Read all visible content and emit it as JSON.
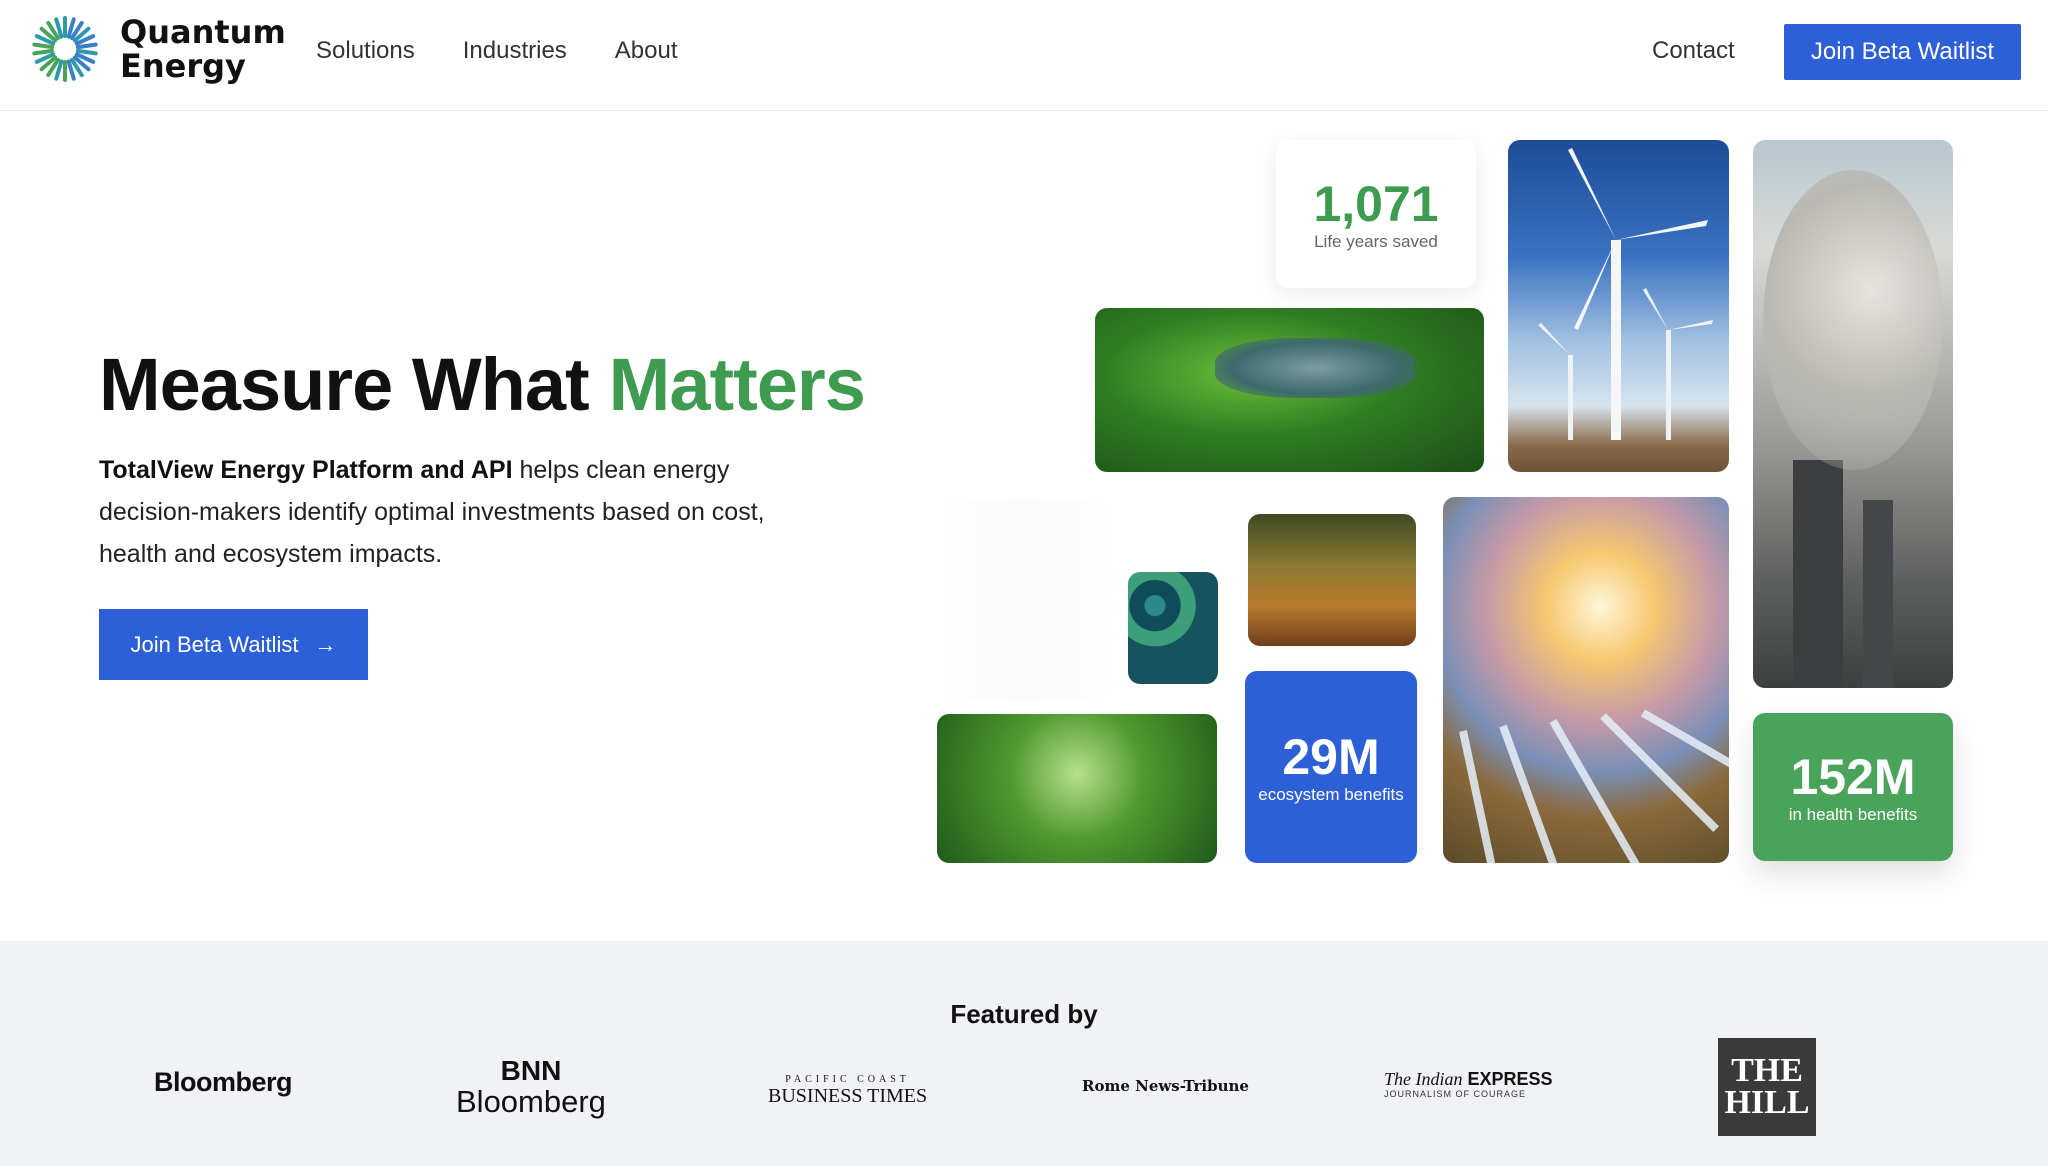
{
  "header": {
    "logo_line1": "Quantum",
    "logo_line2": "Energy",
    "nav": [
      "Solutions",
      "Industries",
      "About"
    ],
    "contact": "Contact",
    "cta": "Join Beta Waitlist"
  },
  "hero": {
    "title_part1": "Measure What",
    "title_part2": "Matters",
    "desc_strong": "TotalView Energy Platform and API",
    "desc_rest": " helps clean energy decision-makers identify optimal investments based on cost, health and ecosystem impacts.",
    "cta": "Join Beta Waitlist"
  },
  "stats": {
    "life_years": {
      "value": "1,071",
      "label": "Life years saved"
    },
    "ecosystem": {
      "value": "29M",
      "label": "ecosystem benefits"
    },
    "health": {
      "value": "152M",
      "label": "in health benefits"
    }
  },
  "colors": {
    "primary_blue": "#2d5fd6",
    "accent_green": "#3e9b4f",
    "stat_green": "#4aa35a",
    "featured_bg": "#f1f2f5"
  },
  "featured": {
    "title": "Featured by",
    "brands": {
      "bloomberg": "Bloomberg",
      "bnn_top": "BNN",
      "bnn_bottom": "Bloomberg",
      "pacific_top": "PACIFIC COAST",
      "pacific_bottom": "BUSINESS TIMES",
      "rome": "Rome News-Tribune",
      "indian_italic": "The Indian",
      "indian_bold": "EXPRESS",
      "indian_tag": "JOURNALISM OF COURAGE",
      "hill_top": "THE",
      "hill_bottom": "HILL"
    }
  }
}
